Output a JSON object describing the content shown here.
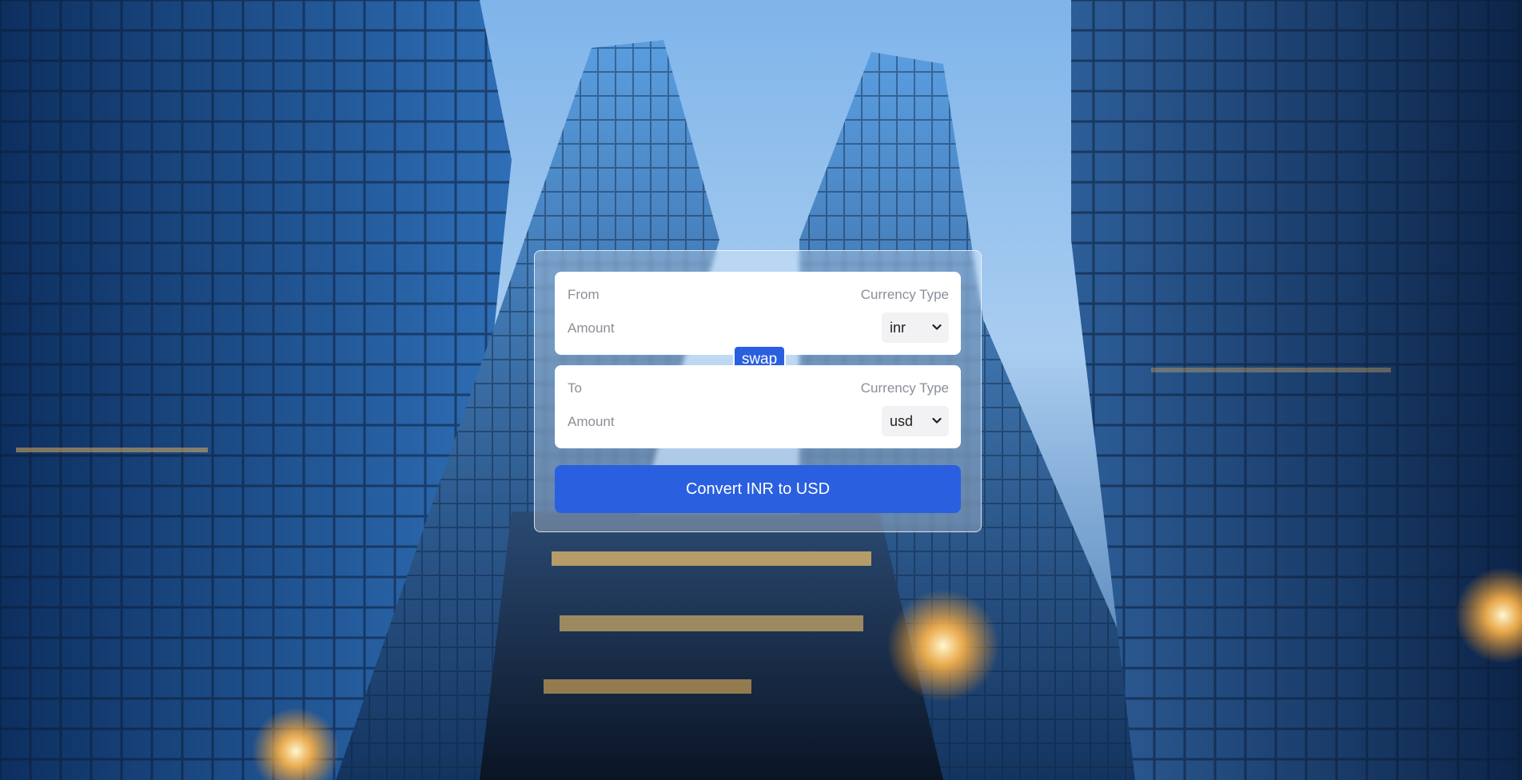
{
  "background": {
    "description_icon": "skyscrapers-photo"
  },
  "converter": {
    "from": {
      "label": "From",
      "currency_type_label": "Currency Type",
      "amount_placeholder": "Amount",
      "currency": "inr"
    },
    "swap_label": "swap",
    "to": {
      "label": "To",
      "currency_type_label": "Currency Type",
      "amount_placeholder": "Amount",
      "currency": "usd"
    },
    "convert_label": "Convert INR to USD"
  },
  "colors": {
    "accent": "#2a5fe0",
    "panel": "#ffffff",
    "muted_text": "#8a8f98"
  }
}
